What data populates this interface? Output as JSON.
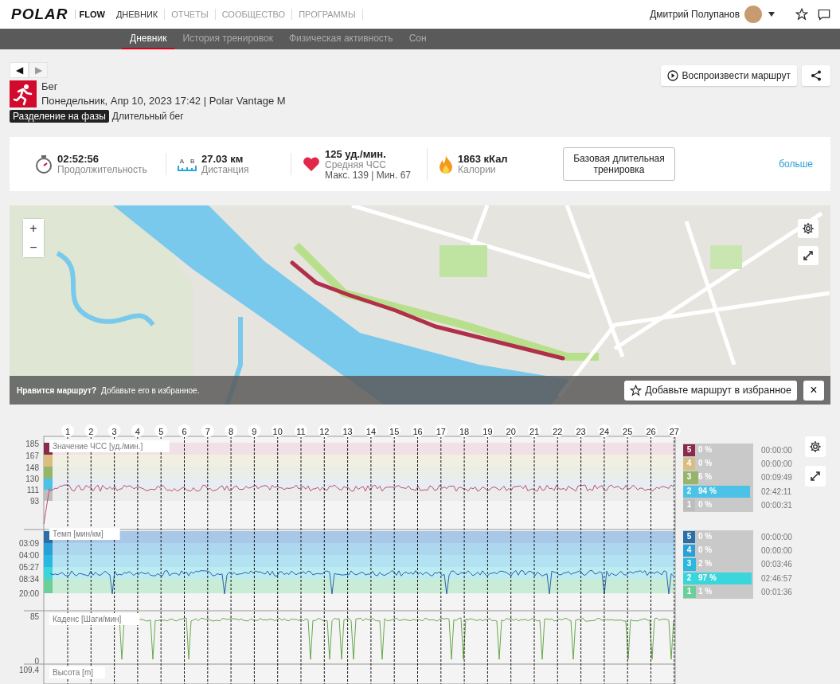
{
  "nav": {
    "logo": "POLAR",
    "brand": "FLOW",
    "items": [
      {
        "label": "ДНЕВНИК",
        "selected": true
      },
      {
        "label": "ОТЧЕТЫ",
        "selected": false
      },
      {
        "label": "СООБЩЕСТВО",
        "selected": false
      },
      {
        "label": "ПРОГРАММЫ",
        "selected": false
      }
    ]
  },
  "user": {
    "name": "Дмитрий Полупанов"
  },
  "subnav": [
    {
      "label": "Дневник",
      "selected": true
    },
    {
      "label": "История тренировок",
      "selected": false
    },
    {
      "label": "Физическая активность",
      "selected": false
    },
    {
      "label": "Сон",
      "selected": false
    }
  ],
  "pager": {
    "prev": {
      "label": "◀",
      "disabled": false
    },
    "next": {
      "label": "▶",
      "disabled": true
    }
  },
  "actions": {
    "replay": "Воспроизвести маршрут"
  },
  "session": {
    "sport": "Бег",
    "datetime": "Понедельник, Апр 10, 2023 17:42 | Polar Vantage M",
    "phase_tag": "Разделение на фазы",
    "phase_name": "Длительный бег"
  },
  "summary": {
    "stats": [
      {
        "kind": "duration",
        "value": "02:52:56",
        "label": "Продолжительность"
      },
      {
        "kind": "distance",
        "value": "27.03 км",
        "label": "Дистанция",
        "ends": [
          "A",
          "B"
        ]
      },
      {
        "kind": "heart",
        "value": "125 уд./мин.",
        "label": "Средняя ЧСС",
        "detail": "Макс. 139  |  Мин. 67"
      },
      {
        "kind": "calories",
        "value": "1863 кКал",
        "label": "Калории"
      }
    ],
    "benefit": "Базовая длительная тренировка",
    "more": "больше"
  },
  "map": {
    "zoom_in": "+",
    "zoom_out": "−",
    "banner_question": "Нравится маршрут?",
    "banner_text": "Добавьте его в избранное.",
    "favorite_button": "Добавьте маршрут в избранное",
    "close": "×"
  },
  "chart": {
    "laps": [
      "1",
      "2",
      "3",
      "4",
      "5",
      "6",
      "7",
      "8",
      "9",
      "10",
      "11",
      "12",
      "13",
      "14",
      "15",
      "16",
      "17",
      "18",
      "19",
      "20",
      "21",
      "22",
      "23",
      "24",
      "25",
      "26",
      "27"
    ],
    "panels": [
      {
        "kind": "hr",
        "title": "Значение ЧСС [уд./мин.]",
        "ticks": [
          "185",
          "167",
          "148",
          "130",
          "111",
          "93"
        ]
      },
      {
        "kind": "pace",
        "title": "Темп [мин/км]",
        "ticks": [
          "03:09",
          "04:00",
          "05:27",
          "08:34",
          "20:00"
        ]
      },
      {
        "kind": "cadence",
        "title": "Каденс [Шаги/мин]",
        "ticks": [
          "85",
          "0"
        ]
      },
      {
        "kind": "altitude",
        "title": "Высота [m]",
        "ticks": [
          "109.4"
        ]
      }
    ],
    "hr_zones": [
      {
        "zone": "5",
        "percent": "0 %",
        "time": "00:00:00",
        "level": 0,
        "color": "#8b2b4b"
      },
      {
        "zone": "4",
        "percent": "0 %",
        "time": "00:00:00",
        "level": 0,
        "color": "#d9be80"
      },
      {
        "zone": "3",
        "percent": "6 %",
        "time": "00:09:49",
        "level": 0.06,
        "color": "#96b56a"
      },
      {
        "zone": "2",
        "percent": "94 %",
        "time": "02:42:11",
        "level": 0.94,
        "color": "#4cc3e6"
      },
      {
        "zone": "1",
        "percent": "0 %",
        "time": "00:00:31",
        "level": 0,
        "color": "#bdbdbd"
      }
    ],
    "pace_zones": [
      {
        "zone": "5",
        "percent": "0 %",
        "time": "00:00:00",
        "level": 0,
        "color": "#2a6fa8"
      },
      {
        "zone": "4",
        "percent": "0 %",
        "time": "00:00:00",
        "level": 0,
        "color": "#2aa0d8"
      },
      {
        "zone": "3",
        "percent": "2 %",
        "time": "00:03:46",
        "level": 0.02,
        "color": "#2ab8e0"
      },
      {
        "zone": "2",
        "percent": "97 %",
        "time": "02:46:57",
        "level": 0.97,
        "color": "#3ad6dc"
      },
      {
        "zone": "1",
        "percent": "1 %",
        "time": "00:01:36",
        "level": 0.01,
        "color": "#6ccf9a"
      }
    ]
  }
}
